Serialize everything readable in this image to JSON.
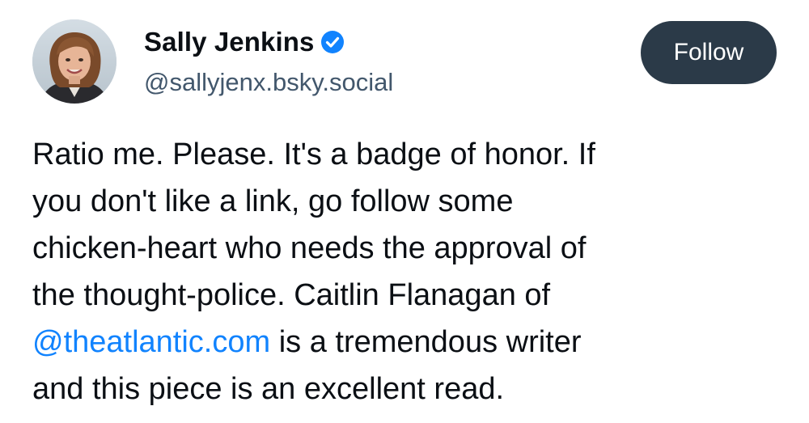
{
  "author": {
    "display_name": "Sally Jenkins",
    "handle": "@sallyjenx.bsky.social",
    "verified_icon": "verified-check-icon",
    "avatar_icon": "avatar"
  },
  "follow_button": {
    "label": "Follow",
    "color": "#2b3a48"
  },
  "post": {
    "lines": [
      "Ratio me. Please. It's a badge of honor. If",
      "you don't like a link, go follow some",
      "chicken-heart who needs the approval of",
      "the thought-police. Caitlin Flanagan of"
    ],
    "mention": "@theatlantic.com",
    "mention_tail": " is a tremendous writer",
    "last_line": "and this piece is an excellent read."
  },
  "colors": {
    "link": "#1183fe",
    "verified": "#1183fe",
    "handle": "#42576c"
  }
}
